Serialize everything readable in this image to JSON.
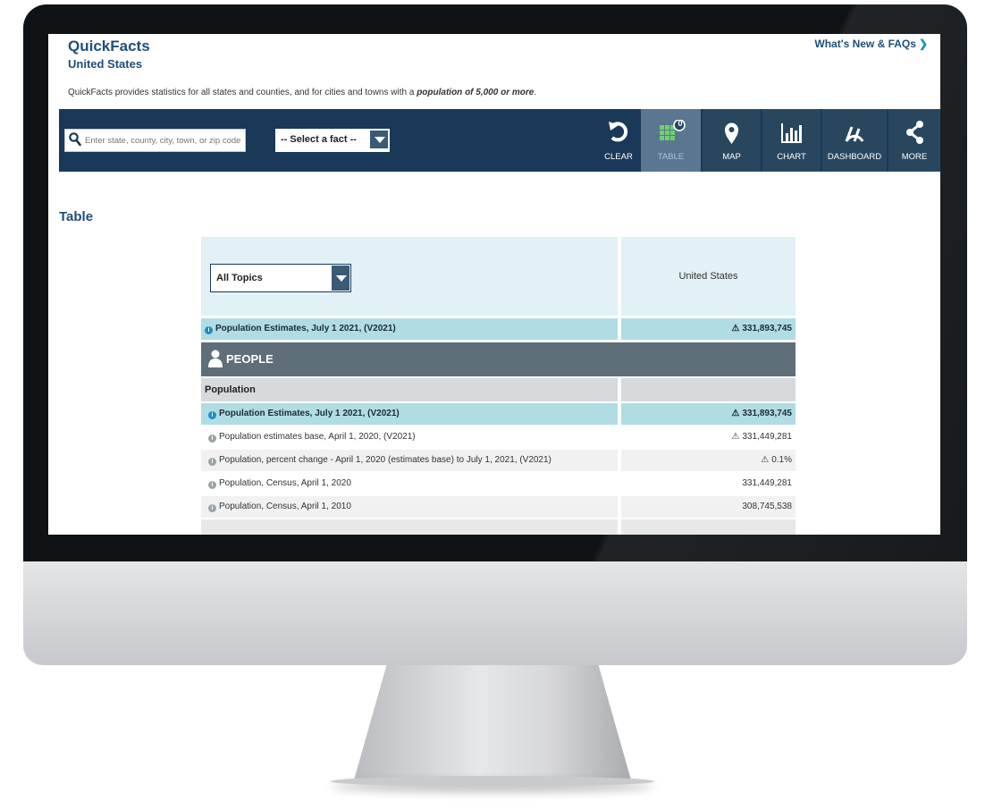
{
  "header": {
    "app_title": "QuickFacts",
    "subtitle": "United States",
    "whats_new": "What's New & FAQs",
    "description_prefix": "QuickFacts provides statistics for all states and counties, and for cities and towns with a ",
    "description_emphasis": "population of 5,000 or more",
    "description_suffix": "."
  },
  "toolbar": {
    "search_placeholder": "Enter state, county, city, town, or zip code",
    "select_fact": "-- Select a fact --",
    "buttons": [
      {
        "label": "CLEAR",
        "icon": "clear-icon"
      },
      {
        "label": "TABLE",
        "icon": "table-icon",
        "badge": "0"
      },
      {
        "label": "MAP",
        "icon": "map-pin-icon"
      },
      {
        "label": "CHART",
        "icon": "bar-chart-icon"
      },
      {
        "label": "DASHBOARD",
        "icon": "gauge-icon"
      },
      {
        "label": "MORE",
        "icon": "share-icon"
      }
    ]
  },
  "table_section": {
    "heading": "Table",
    "topics_select": "All Topics",
    "column_header": "United States",
    "summary_row": {
      "label": "Population Estimates, July 1 2021, (V2021)",
      "value": "331,893,745"
    },
    "people_label": "PEOPLE",
    "population_label": "Population",
    "rows": [
      {
        "label": "Population Estimates, July 1 2021, (V2021)",
        "value": "331,893,745",
        "highlight": true,
        "warn": true
      },
      {
        "label": "Population estimates base, April 1, 2020, (V2021)",
        "value": "331,449,281",
        "highlight": false,
        "warn": true
      },
      {
        "label": "Population, percent change - April 1, 2020 (estimates base) to July 1, 2021, (V2021)",
        "value": "0.1%",
        "highlight": false,
        "warn": true
      },
      {
        "label": "Population, Census, April 1, 2020",
        "value": "331,449,281",
        "highlight": false,
        "warn": false
      },
      {
        "label": "Population, Census, April 1, 2010",
        "value": "308,745,538",
        "highlight": false,
        "warn": false
      }
    ]
  },
  "colors": {
    "navbar": "#1a3958",
    "title": "#1f4e79",
    "highlight_row": "#b0dde3",
    "people_bar": "#5e6f7a"
  }
}
